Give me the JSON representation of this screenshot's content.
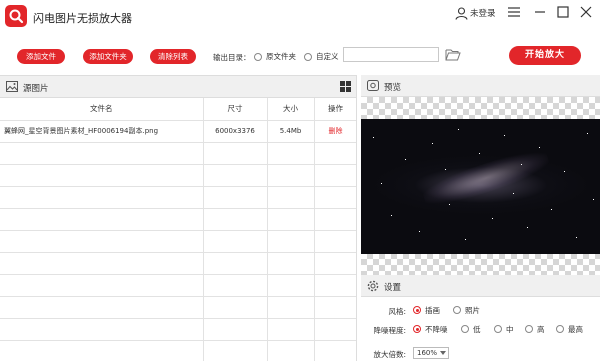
{
  "app": {
    "title": "闪电图片无损放大器"
  },
  "titlebar": {
    "login_label": "未登录"
  },
  "toolbar": {
    "add_file": "添加文件",
    "add_folder": "添加文件夹",
    "clear_list": "清除列表",
    "output_dir_label": "输出目录：",
    "output_options": [
      {
        "label": "原文件夹",
        "selected": false
      },
      {
        "label": "自定义",
        "selected": false
      }
    ],
    "path_value": "",
    "start_button": "开始放大"
  },
  "source_panel": {
    "title": "源图片",
    "columns": [
      "文件名",
      "尺寸",
      "大小",
      "操作"
    ],
    "rows": [
      {
        "name": "翼蜂网_星空背景图片素材_HF0006194副本.png",
        "size": "6000x3376",
        "filesize": "5.4Mb",
        "action": "删除"
      }
    ]
  },
  "preview_panel": {
    "title": "预览"
  },
  "settings_panel": {
    "title": "设置",
    "style_label": "风格:",
    "style_options": [
      {
        "label": "插画",
        "selected": true
      },
      {
        "label": "照片",
        "selected": false
      }
    ],
    "denoise_label": "降噪程度:",
    "denoise_options": [
      {
        "label": "不降噪",
        "selected": true
      },
      {
        "label": "低",
        "selected": false
      },
      {
        "label": "中",
        "selected": false
      },
      {
        "label": "高",
        "selected": false
      },
      {
        "label": "最高",
        "selected": false
      }
    ],
    "zoom_label": "放大倍数:",
    "zoom_value": "160%"
  },
  "colors": {
    "accent": "#e2262a",
    "header_bg": "#f0f0f0"
  }
}
